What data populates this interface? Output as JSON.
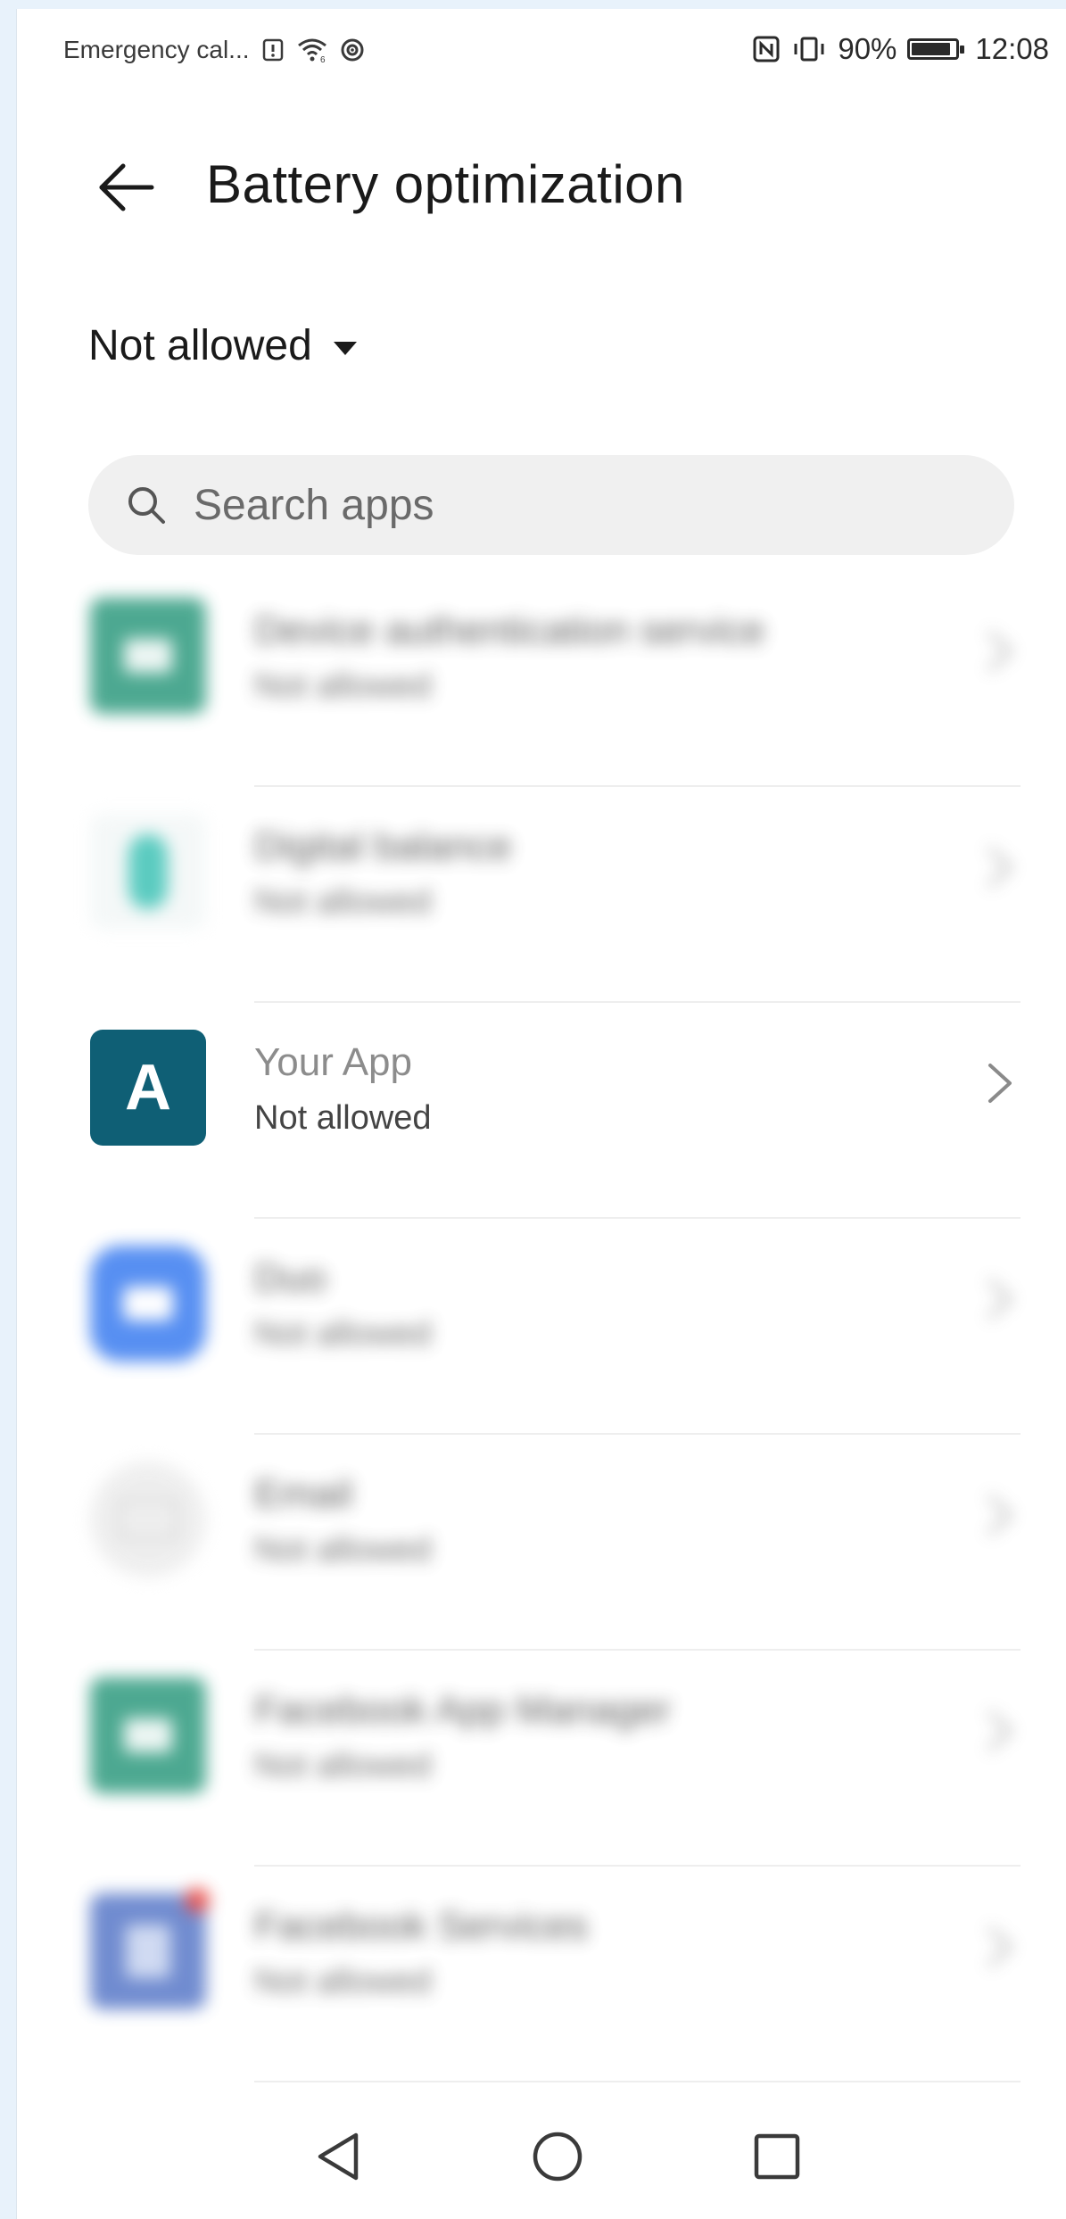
{
  "status_bar": {
    "carrier": "Emergency cal...",
    "battery_percent": "90%",
    "time": "12:08",
    "icons": [
      "sim-alert-icon",
      "wifi-icon",
      "hotspot-icon",
      "nfc-icon",
      "vibrate-icon",
      "battery-icon"
    ]
  },
  "header": {
    "title": "Battery optimization",
    "back_icon": "arrow-left-icon"
  },
  "filter": {
    "selected": "Not allowed"
  },
  "search": {
    "placeholder": "Search apps"
  },
  "apps": [
    {
      "name": "Device authentication service",
      "status": "Not allowed",
      "icon_color": "#2e9a7e",
      "blurred": true
    },
    {
      "name": "Digital balance",
      "status": "Not allowed",
      "icon_color": "#3fc3b6",
      "blurred": true
    },
    {
      "name": "Your App",
      "status": "Not allowed",
      "icon_color": "#0f5f75",
      "icon_letter": "A",
      "blurred": false
    },
    {
      "name": "Duo",
      "status": "Not allowed",
      "icon_color": "#3a7cf0",
      "blurred": true
    },
    {
      "name": "Email",
      "status": "Not allowed",
      "icon_color": "#e8e8e8",
      "blurred": true
    },
    {
      "name": "Facebook App Manager",
      "status": "Not allowed",
      "icon_color": "#2e9a7e",
      "blurred": true
    },
    {
      "name": "Facebook Services",
      "status": "Not allowed",
      "icon_color": "#5878c8",
      "blurred": true
    }
  ],
  "nav": {
    "icons": [
      "back-triangle-icon",
      "home-circle-icon",
      "recents-square-icon"
    ]
  }
}
